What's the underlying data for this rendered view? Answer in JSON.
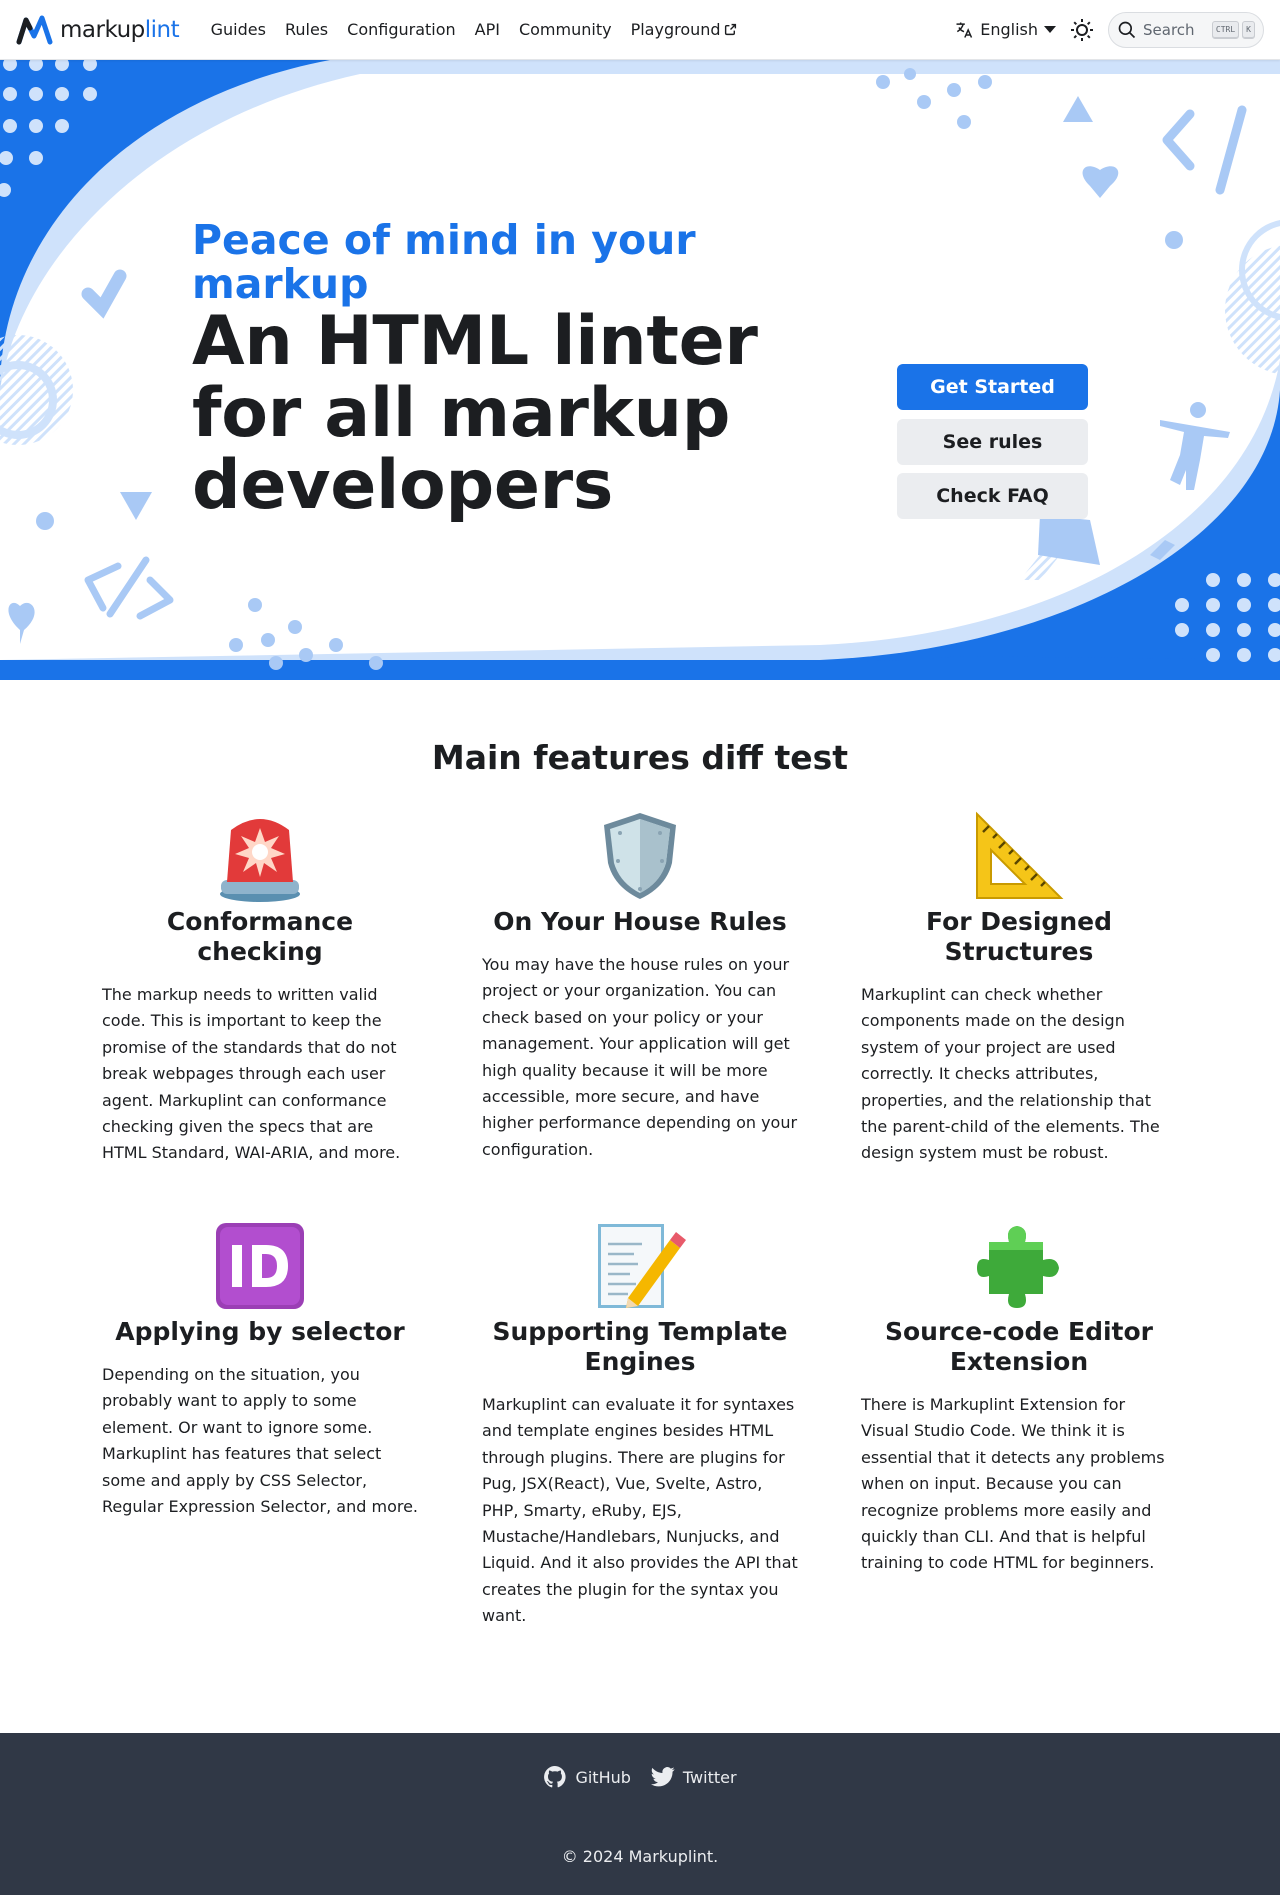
{
  "navbar": {
    "brand": {
      "part1": "markup",
      "part2": "lint"
    },
    "links": [
      "Guides",
      "Rules",
      "Configuration",
      "API",
      "Community",
      "Playground"
    ],
    "language": "English",
    "search": {
      "label": "Search",
      "key1": "CTRL",
      "key2": "K"
    }
  },
  "hero": {
    "subtitle": "Peace of mind in your markup",
    "title": "An HTML linter for all markup developers",
    "buttons": {
      "primary": "Get Started",
      "rules": "See rules",
      "faq": "Check FAQ"
    }
  },
  "features": {
    "heading": "Main features diff test",
    "items": [
      {
        "icon": "siren-icon",
        "title": "Conformance checking",
        "text": "The markup needs to written valid code. This is important to keep the promise of the standards that do not break webpages through each user agent. Markuplint can conformance checking given the specs that are HTML Standard, WAI-ARIA, and more."
      },
      {
        "icon": "shield-icon",
        "title": "On Your House Rules",
        "text": "You may have the house rules on your project or your organization. You can check based on your policy or your management. Your application will get high quality because it will be more accessible, more secure, and have higher performance depending on your configuration."
      },
      {
        "icon": "triangular-ruler-icon",
        "title": "For Designed Structures",
        "text": "Markuplint can check whether components made on the design system of your project are used correctly. It checks attributes, properties, and the relationship that the parent-child of the elements. The design system must be robust."
      },
      {
        "icon": "id-icon",
        "title": "Applying by selector",
        "text": "Depending on the situation, you probably want to apply to some element. Or want to ignore some. Markuplint has features that select some and apply by CSS Selector, Regular Expression Selector, and more."
      },
      {
        "icon": "memo-icon",
        "title": "Supporting Template Engines",
        "text": "Markuplint can evaluate it for syntaxes and template engines besides HTML through plugins. There are plugins for Pug, JSX(React), Vue, Svelte, Astro, PHP, Smarty, eRuby, EJS, Mustache/Handlebars, Nunjucks, and Liquid. And it also provides the API that creates the plugin for the syntax you want."
      },
      {
        "icon": "puzzle-piece-icon",
        "title": "Source-code Editor Extension",
        "text": "There is Markuplint Extension for Visual Studio Code. We think it is essential that it detects any problems when on input. Because you can recognize problems more easily and quickly than CLI. And that is helpful training to code HTML for beginners."
      }
    ]
  },
  "footer": {
    "links": [
      "GitHub",
      "Twitter"
    ],
    "copyright": "© 2024 Markuplint."
  },
  "colors": {
    "accent": "#1a73e8",
    "light_accent": "#cfe2fb",
    "footer_bg": "#303846"
  }
}
